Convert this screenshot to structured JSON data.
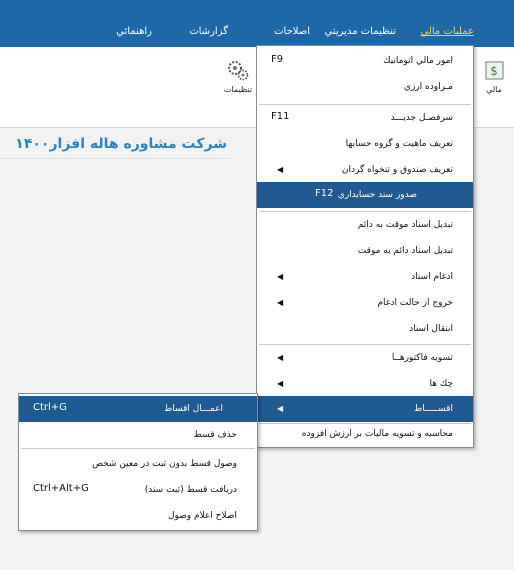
{
  "menubar": {
    "items": [
      "عمليات مالي",
      "تنظيمات مديريتي",
      "اصلاحات",
      "گزارشات",
      "راهنمائي"
    ]
  },
  "ribbon": {
    "settings_label": "تنظيمات",
    "right_tool_label": "مالي"
  },
  "company_title": "شرکت مشاوره هاله افزار۱۴۰۰",
  "dropdown": {
    "items": [
      {
        "label": "امور مالي اتوماتيك",
        "key": "F9"
      },
      {
        "label": "مـراوده ارزي"
      },
      {
        "label": "سرفصـل جديـــد",
        "key": "F11"
      },
      {
        "label": "تعريف ماهيت و گروه حسابها"
      },
      {
        "label": "تعريف صندوق و تنخواه گردان"
      },
      {
        "label": "صدور سند حسابداري",
        "key": "F12"
      },
      {
        "label": "تبديل اسناد موقت به دائم"
      },
      {
        "label": "تبديل اسناد دائم به موقت"
      },
      {
        "label": "ادغام اسناد"
      },
      {
        "label": "خروج از حالت ادغام"
      },
      {
        "label": "انتقال اسناد"
      },
      {
        "label": "تسويه فاكتورهــا"
      },
      {
        "label": "چك ها"
      },
      {
        "label": "اقســـــاط"
      },
      {
        "label": "محاسبه و تسويه ماليات بر ارزش افزوده"
      }
    ]
  },
  "submenu": {
    "items": [
      {
        "label": "اعمـــال اقساط",
        "key": "Ctrl+G"
      },
      {
        "label": "حذف قسط"
      },
      {
        "label": "وصول قسط بدون ثبت در معين شخص"
      },
      {
        "label": "دريافت قسط (ثبت سند)",
        "key": "Ctrl+Alt+G"
      },
      {
        "label": "اصلاح اعلام وصول"
      }
    ]
  },
  "colors": {
    "menubar": "#1f68a8",
    "highlight": "#1f5a92",
    "active_menu_text": "#ffd34a",
    "company_text": "#2a82c7"
  }
}
